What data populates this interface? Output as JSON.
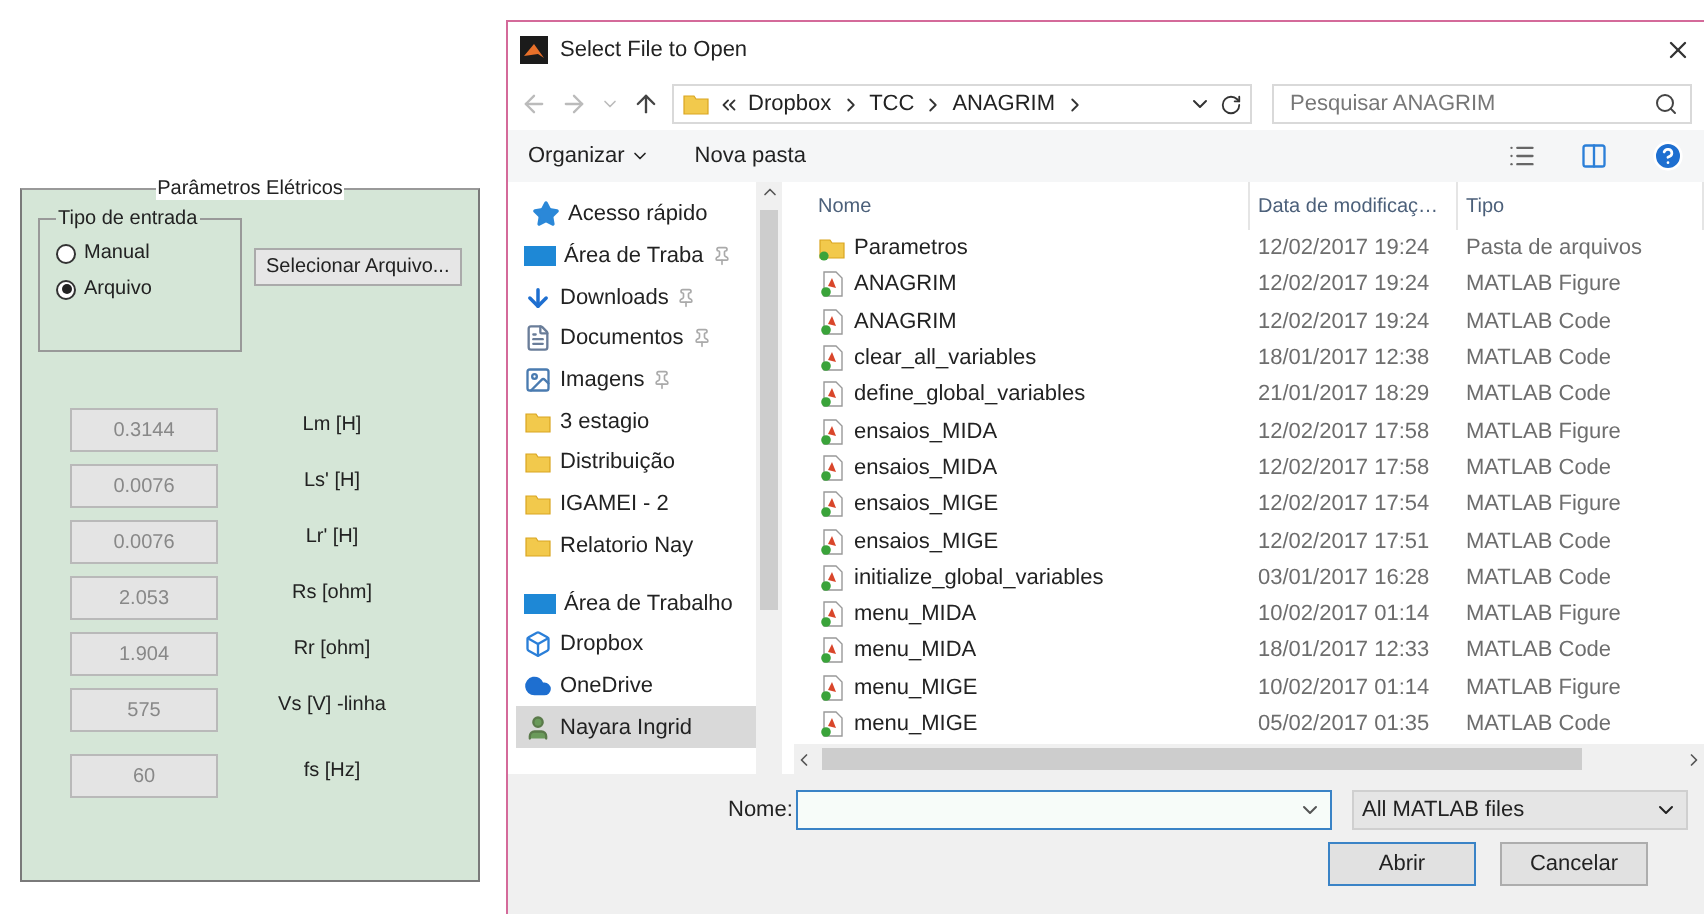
{
  "panel": {
    "title": "Parâmetros Elétricos",
    "input_type": {
      "title": "Tipo de entrada",
      "options": [
        {
          "label": "Manual",
          "selected": false
        },
        {
          "label": "Arquivo",
          "selected": true
        }
      ]
    },
    "select_button": "Selecionar Arquivo...",
    "parameters": [
      {
        "value": "0.3144",
        "label": "Lm [H]"
      },
      {
        "value": "0.0076",
        "label": "Ls' [H]"
      },
      {
        "value": "0.0076",
        "label": "Lr' [H]"
      },
      {
        "value": "2.053",
        "label": "Rs [ohm]"
      },
      {
        "value": "1.904",
        "label": "Rr [ohm]"
      },
      {
        "value": "575",
        "label": "Vs [V] -linha"
      },
      {
        "value": "60",
        "label": "fs [Hz]"
      }
    ]
  },
  "dialog": {
    "title": "Select File to Open",
    "breadcrumb": [
      "Dropbox",
      "TCC",
      "ANAGRIM"
    ],
    "search": {
      "placeholder": "Pesquisar ANAGRIM"
    },
    "toolbar": [
      "Organizar",
      "Nova pasta"
    ],
    "sidebar": [
      {
        "label": "Acesso rápido",
        "kind": "star",
        "pinned": false,
        "selected": false
      },
      {
        "label": "Área de Traba",
        "kind": "desktop",
        "pinned": true,
        "selected": false
      },
      {
        "label": "Downloads",
        "kind": "download",
        "pinned": true,
        "selected": false
      },
      {
        "label": "Documentos",
        "kind": "document",
        "pinned": true,
        "selected": false
      },
      {
        "label": "Imagens",
        "kind": "image",
        "pinned": true,
        "selected": false
      },
      {
        "label": "3 estagio",
        "kind": "folder",
        "pinned": false,
        "selected": false
      },
      {
        "label": "Distribuição",
        "kind": "folder",
        "pinned": false,
        "selected": false
      },
      {
        "label": "IGAMEI - 2",
        "kind": "folder",
        "pinned": false,
        "selected": false
      },
      {
        "label": "Relatorio Nay",
        "kind": "folder",
        "pinned": false,
        "selected": false
      },
      {
        "label": "Área de Trabalho",
        "kind": "desktop",
        "pinned": false,
        "selected": false
      },
      {
        "label": "Dropbox",
        "kind": "dropbox",
        "pinned": false,
        "selected": false
      },
      {
        "label": "OneDrive",
        "kind": "cloud",
        "pinned": false,
        "selected": false
      },
      {
        "label": "Nayara Ingrid",
        "kind": "user",
        "pinned": false,
        "selected": true
      }
    ],
    "columns": [
      "Nome",
      "Data de modificaç…",
      "Tipo"
    ],
    "rows": [
      {
        "kind": "folder",
        "name": "Parametros",
        "date": "12/02/2017 19:24",
        "type": "Pasta de arquivos"
      },
      {
        "kind": "file",
        "name": "ANAGRIM",
        "date": "12/02/2017 19:24",
        "type": "MATLAB Figure"
      },
      {
        "kind": "file",
        "name": "ANAGRIM",
        "date": "12/02/2017 19:24",
        "type": "MATLAB Code"
      },
      {
        "kind": "file",
        "name": "clear_all_variables",
        "date": "18/01/2017 12:38",
        "type": "MATLAB Code"
      },
      {
        "kind": "file",
        "name": "define_global_variables",
        "date": "21/01/2017 18:29",
        "type": "MATLAB Code"
      },
      {
        "kind": "file",
        "name": "ensaios_MIDA",
        "date": "12/02/2017 17:58",
        "type": "MATLAB Figure"
      },
      {
        "kind": "file",
        "name": "ensaios_MIDA",
        "date": "12/02/2017 17:58",
        "type": "MATLAB Code"
      },
      {
        "kind": "file",
        "name": "ensaios_MIGE",
        "date": "12/02/2017 17:54",
        "type": "MATLAB Figure"
      },
      {
        "kind": "file",
        "name": "ensaios_MIGE",
        "date": "12/02/2017 17:51",
        "type": "MATLAB Code"
      },
      {
        "kind": "file",
        "name": "initialize_global_variables",
        "date": "03/01/2017 16:28",
        "type": "MATLAB Code"
      },
      {
        "kind": "file",
        "name": "menu_MIDA",
        "date": "10/02/2017 01:14",
        "type": "MATLAB Figure"
      },
      {
        "kind": "file",
        "name": "menu_MIDA",
        "date": "18/01/2017 12:33",
        "type": "MATLAB Code"
      },
      {
        "kind": "file",
        "name": "menu_MIGE",
        "date": "10/02/2017 01:14",
        "type": "MATLAB Figure"
      },
      {
        "kind": "file",
        "name": "menu_MIGE",
        "date": "05/02/2017 01:35",
        "type": "MATLAB Code"
      }
    ],
    "filename_label": "Nome:",
    "filter": "All MATLAB files",
    "buttons": [
      "Abrir",
      "Cancelar"
    ]
  }
}
